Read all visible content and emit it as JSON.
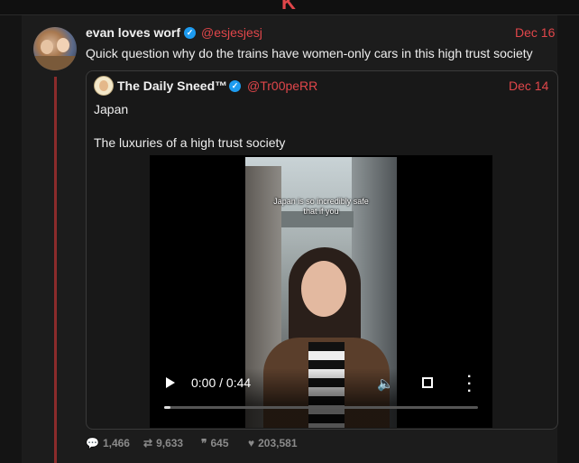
{
  "app": {
    "logo_glyph": "K"
  },
  "post": {
    "author_name": "evan loves worf",
    "handle": "@esjesjesj",
    "date": "Dec 16",
    "text": "Quick question why do the trains have women-only cars in this high trust society",
    "stats": {
      "replies": "1,466",
      "reposts": "9,633",
      "quotes": "645",
      "likes": "203,581"
    }
  },
  "quoted": {
    "author_name": "The Daily Sneed™",
    "handle": "@Tr00peRR",
    "date": "Dec 14",
    "line1": "Japan",
    "line2": "The luxuries of a high trust society",
    "video": {
      "caption": "Japan is so incredibly safe that if you",
      "time": "0:00 / 0:44",
      "progress": 0.0
    }
  },
  "icons": {
    "verified": "verified-badge-icon",
    "reply": "speech-bubble-icon",
    "repost": "repost-icon",
    "quote": "quote-icon",
    "like": "heart-icon",
    "play": "play-icon",
    "volume": "volume-icon",
    "fullscreen": "fullscreen-icon",
    "more": "more-vertical-icon"
  },
  "colors": {
    "accent": "#e0464a",
    "verified": "#1d9bf0",
    "background": "#141414"
  }
}
